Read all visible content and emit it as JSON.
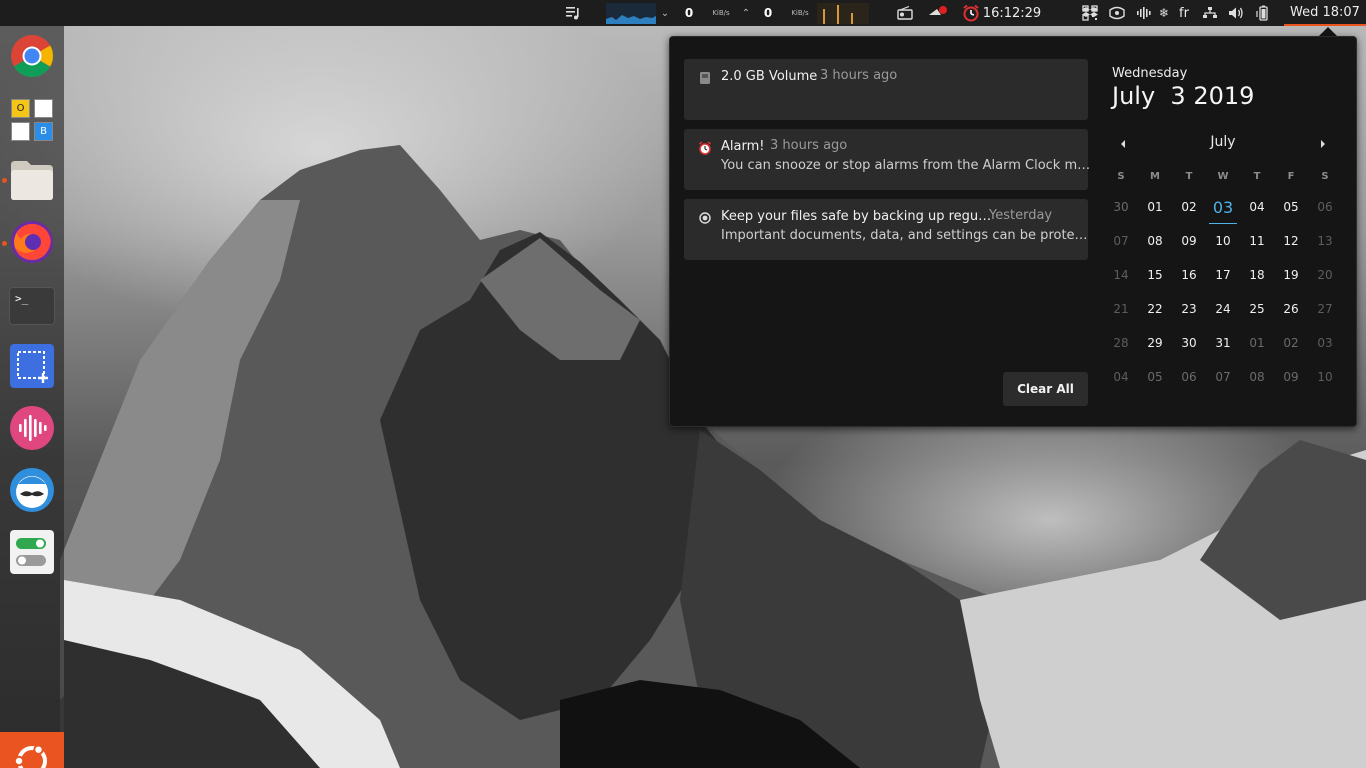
{
  "topbar": {
    "net_down_value": "0",
    "net_down_unit": "KiB/s",
    "net_up_value": "0",
    "net_up_unit": "KiB/s",
    "alarm_time": "16:12:29",
    "keyboard_layout": "fr",
    "datetime": "Wed 18:07",
    "accent_color": "#e95420"
  },
  "dock": {
    "items": [
      {
        "icon": "chrome-icon"
      },
      {
        "icon": "office-apps-icon",
        "letters": [
          "O",
          "",
          "",
          "B"
        ]
      },
      {
        "icon": "files-icon"
      },
      {
        "icon": "firefox-icon"
      },
      {
        "icon": "terminal-icon",
        "glyph": ">_"
      },
      {
        "icon": "screenshot-icon"
      },
      {
        "icon": "audio-recorder-icon"
      },
      {
        "icon": "mustache-app-icon"
      },
      {
        "icon": "toggle-settings-icon"
      }
    ],
    "apps_button_icon": "ubuntu-logo-icon"
  },
  "notifications": [
    {
      "title": "2.0 GB Volume",
      "time": "3 hours ago",
      "body": "",
      "icon": "drive-icon"
    },
    {
      "title": "Alarm!",
      "time": "3 hours ago",
      "body": "You can snooze or stop alarms from the Alarm Clock m…",
      "icon": "alarm-icon"
    },
    {
      "title": "Keep your files safe by backing up regu…",
      "time": "Yesterday",
      "body": "Important documents, data, and settings can be prote…",
      "icon": "backup-icon"
    }
  ],
  "clear_all_label": "Clear All",
  "calendar": {
    "weekday": "Wednesday",
    "date": "July  3 2019",
    "month_label": "July",
    "days_of_week": [
      "S",
      "M",
      "T",
      "W",
      "T",
      "F",
      "S"
    ],
    "weeks": [
      [
        "30",
        "01",
        "02",
        "03",
        "04",
        "05",
        "06"
      ],
      [
        "07",
        "08",
        "09",
        "10",
        "11",
        "12",
        "13"
      ],
      [
        "14",
        "15",
        "16",
        "17",
        "18",
        "19",
        "20"
      ],
      [
        "21",
        "22",
        "23",
        "24",
        "25",
        "26",
        "27"
      ],
      [
        "28",
        "29",
        "30",
        "31",
        "01",
        "02",
        "03"
      ],
      [
        "04",
        "05",
        "06",
        "07",
        "08",
        "09",
        "10"
      ]
    ],
    "today": "03",
    "today_color": "#4fb3e8"
  }
}
